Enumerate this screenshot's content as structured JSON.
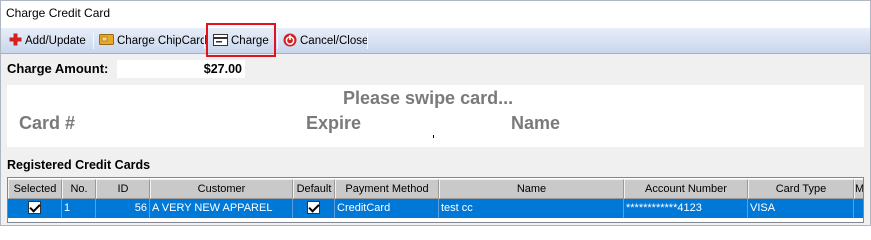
{
  "window": {
    "title": "Charge Credit Card"
  },
  "toolbar": {
    "add_update": "Add/Update",
    "charge_chipcard": "Charge ChipCard",
    "charge": "Charge",
    "cancel_close": "Cancel/Close"
  },
  "amount": {
    "label": "Charge Amount:",
    "value": "$27.00"
  },
  "swipe": {
    "message": "Please swipe card...",
    "card_label": "Card #",
    "expire_label": "Expire",
    "name_label": "Name"
  },
  "registered": {
    "title": "Registered Credit Cards",
    "columns": [
      "Selected",
      "No.",
      "ID",
      "Customer",
      "Default",
      "Payment Method",
      "Name",
      "Account Number",
      "Card Type",
      "Me"
    ],
    "rows": [
      {
        "selected": true,
        "no": "1",
        "id": "56",
        "customer": "A VERY NEW APPAREL",
        "default": true,
        "payment_method": "CreditCard",
        "name": "test cc",
        "account_number": "************4123",
        "card_type": "VISA",
        "me": ""
      }
    ]
  },
  "colors": {
    "highlight": "#e0141e",
    "selection": "#0078d7",
    "toolbar_top": "#e8eef8",
    "toolbar_bottom": "#c8d6ec"
  }
}
